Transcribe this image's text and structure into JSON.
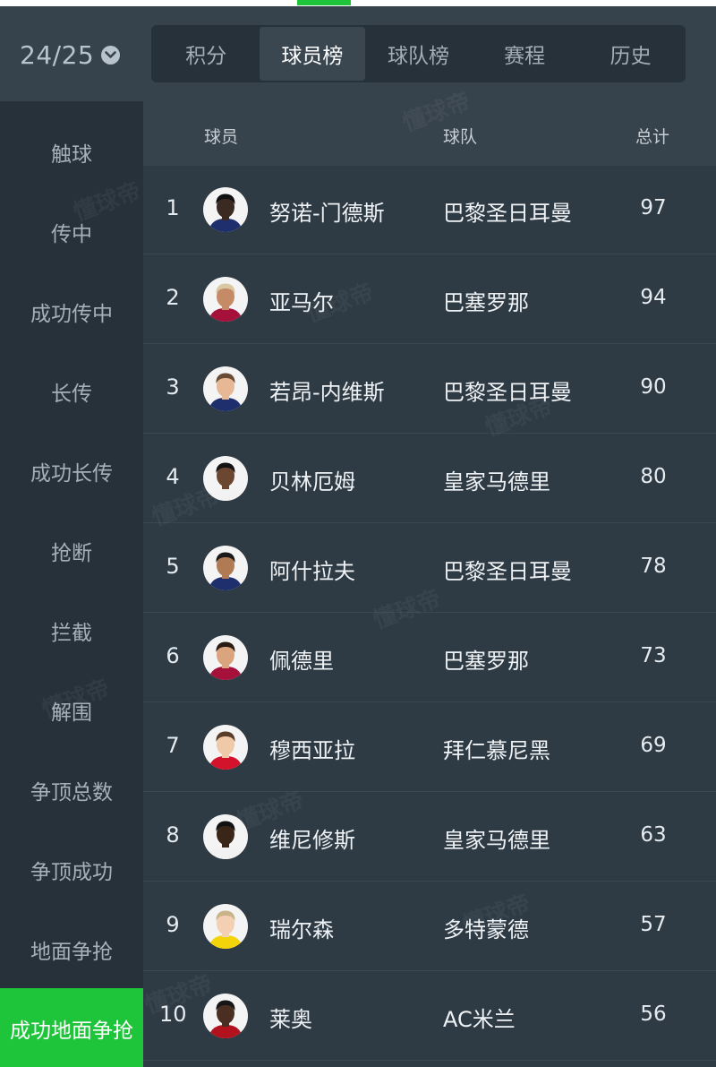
{
  "season": {
    "label": "24/25"
  },
  "tabs": [
    {
      "label": "积分",
      "active": false
    },
    {
      "label": "球员榜",
      "active": true
    },
    {
      "label": "球队榜",
      "active": false
    },
    {
      "label": "赛程",
      "active": false
    },
    {
      "label": "历史",
      "active": false
    }
  ],
  "sidebar": {
    "items": [
      {
        "label": "触球",
        "active": false
      },
      {
        "label": "传中",
        "active": false
      },
      {
        "label": "成功传中",
        "active": false
      },
      {
        "label": "长传",
        "active": false
      },
      {
        "label": "成功长传",
        "active": false
      },
      {
        "label": "抢断",
        "active": false
      },
      {
        "label": "拦截",
        "active": false
      },
      {
        "label": "解围",
        "active": false
      },
      {
        "label": "争顶总数",
        "active": false
      },
      {
        "label": "争顶成功",
        "active": false
      },
      {
        "label": "地面争抢",
        "active": false
      },
      {
        "label": "成功地面争抢",
        "active": true
      }
    ]
  },
  "table": {
    "headers": {
      "player": "球员",
      "team": "球队",
      "total": "总计"
    },
    "rows": [
      {
        "rank": "1",
        "player": "努诺-门德斯",
        "team": "巴黎圣日耳曼",
        "total": "97"
      },
      {
        "rank": "2",
        "player": "亚马尔",
        "team": "巴塞罗那",
        "total": "94"
      },
      {
        "rank": "3",
        "player": "若昂-内维斯",
        "team": "巴黎圣日耳曼",
        "total": "90"
      },
      {
        "rank": "4",
        "player": "贝林厄姆",
        "team": "皇家马德里",
        "total": "80"
      },
      {
        "rank": "5",
        "player": "阿什拉夫",
        "team": "巴黎圣日耳曼",
        "total": "78"
      },
      {
        "rank": "6",
        "player": "佩德里",
        "team": "巴塞罗那",
        "total": "73"
      },
      {
        "rank": "7",
        "player": "穆西亚拉",
        "team": "拜仁慕尼黑",
        "total": "69"
      },
      {
        "rank": "8",
        "player": "维尼修斯",
        "team": "皇家马德里",
        "total": "63"
      },
      {
        "rank": "9",
        "player": "瑞尔森",
        "team": "多特蒙德",
        "total": "57"
      },
      {
        "rank": "10",
        "player": "莱奥",
        "team": "AC米兰",
        "total": "56"
      }
    ]
  },
  "watermark": {
    "text": "懂球帝"
  },
  "colors": {
    "accent": "#1ec53a",
    "background": "#2b3640",
    "sidebar": "#26313a"
  }
}
